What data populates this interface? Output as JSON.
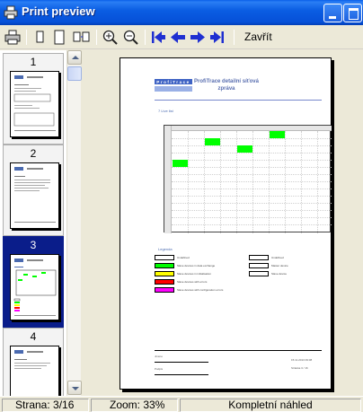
{
  "window": {
    "title": "Print preview"
  },
  "toolbar": {
    "close_label": "Zavřít"
  },
  "thumbnails": [
    {
      "number": "1",
      "selected": false
    },
    {
      "number": "2",
      "selected": false
    },
    {
      "number": "3",
      "selected": true
    },
    {
      "number": "4",
      "selected": false
    }
  ],
  "page": {
    "title_line1": "ProfiTrace detailní síťová",
    "title_line2": "zpráva",
    "logo_text": "ProfiTrace",
    "section": "7 Live list",
    "legend_title": "Legenda",
    "legend": [
      {
        "label": "Undefined",
        "color": "#ffffff"
      },
      {
        "label": "Slave devices in data exchange",
        "color": "#00ff00"
      },
      {
        "label": "Slave devices in initialisation",
        "color": "#ffff00"
      },
      {
        "label": "Slave devices with errors",
        "color": "#ff0000"
      },
      {
        "label": "Slave devices with configuration errors",
        "color": "#ff00ff"
      }
    ],
    "legend_right": [
      {
        "label": "Undefined",
        "color": "#ffffff"
      },
      {
        "label": "Master device",
        "color": "#ffffff"
      },
      {
        "label": "Slave device",
        "color": "#ffffff"
      }
    ],
    "footer_left1": "Jméno",
    "footer_left2": "Podpis",
    "footer_right1": "15.11.2013 09:08",
    "footer_right2": "Stránka 3 / 16"
  },
  "status": {
    "page": "Strana: 3/16",
    "zoom": "Zoom: 33%",
    "mode": "Kompletní náhled"
  },
  "colors": {
    "titlebar": "#0a5fe8",
    "selected_thumb": "#0a1d8a",
    "toolbar_arrows": "#1f2fd1",
    "live_cell": "#00ff00"
  }
}
